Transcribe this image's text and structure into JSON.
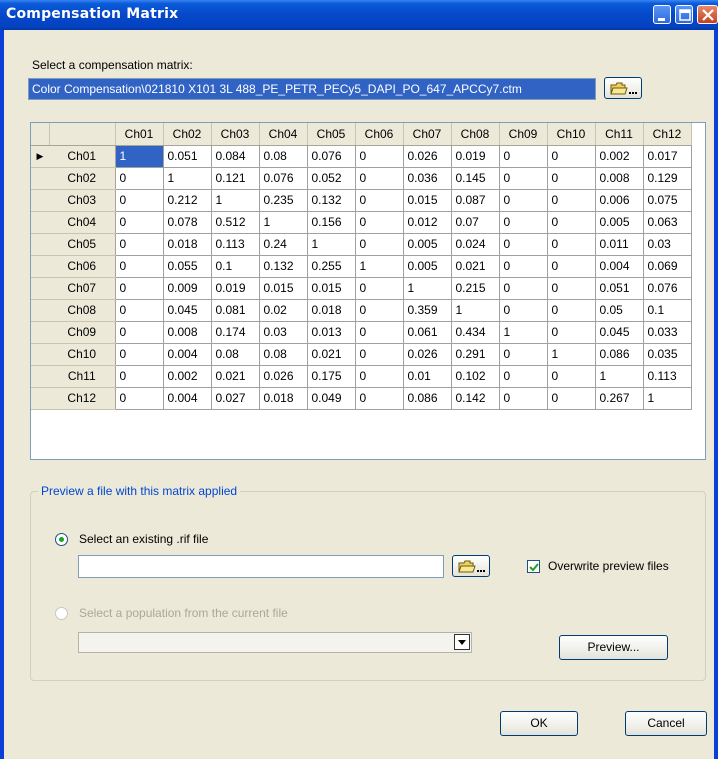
{
  "window": {
    "title": "Compensation Matrix"
  },
  "selector": {
    "label": "Select a compensation matrix:",
    "path": "Color Compensation\\021810 X101 3L 488_PE_PETR_PECy5_DAPI_PO_647_APCCy7.ctm",
    "browse_icon": "folder-open-icon"
  },
  "matrix": {
    "columns": [
      "Ch01",
      "Ch02",
      "Ch03",
      "Ch04",
      "Ch05",
      "Ch06",
      "Ch07",
      "Ch08",
      "Ch09",
      "Ch10",
      "Ch11",
      "Ch12"
    ],
    "rows": [
      {
        "label": "Ch01",
        "values": [
          "1",
          "0.051",
          "0.084",
          "0.08",
          "0.076",
          "0",
          "0.026",
          "0.019",
          "0",
          "0",
          "0.002",
          "0.017"
        ]
      },
      {
        "label": "Ch02",
        "values": [
          "0",
          "1",
          "0.121",
          "0.076",
          "0.052",
          "0",
          "0.036",
          "0.145",
          "0",
          "0",
          "0.008",
          "0.129"
        ]
      },
      {
        "label": "Ch03",
        "values": [
          "0",
          "0.212",
          "1",
          "0.235",
          "0.132",
          "0",
          "0.015",
          "0.087",
          "0",
          "0",
          "0.006",
          "0.075"
        ]
      },
      {
        "label": "Ch04",
        "values": [
          "0",
          "0.078",
          "0.512",
          "1",
          "0.156",
          "0",
          "0.012",
          "0.07",
          "0",
          "0",
          "0.005",
          "0.063"
        ]
      },
      {
        "label": "Ch05",
        "values": [
          "0",
          "0.018",
          "0.113",
          "0.24",
          "1",
          "0",
          "0.005",
          "0.024",
          "0",
          "0",
          "0.011",
          "0.03"
        ]
      },
      {
        "label": "Ch06",
        "values": [
          "0",
          "0.055",
          "0.1",
          "0.132",
          "0.255",
          "1",
          "0.005",
          "0.021",
          "0",
          "0",
          "0.004",
          "0.069"
        ]
      },
      {
        "label": "Ch07",
        "values": [
          "0",
          "0.009",
          "0.019",
          "0.015",
          "0.015",
          "0",
          "1",
          "0.215",
          "0",
          "0",
          "0.051",
          "0.076"
        ]
      },
      {
        "label": "Ch08",
        "values": [
          "0",
          "0.045",
          "0.081",
          "0.02",
          "0.018",
          "0",
          "0.359",
          "1",
          "0",
          "0",
          "0.05",
          "0.1"
        ]
      },
      {
        "label": "Ch09",
        "values": [
          "0",
          "0.008",
          "0.174",
          "0.03",
          "0.013",
          "0",
          "0.061",
          "0.434",
          "1",
          "0",
          "0.045",
          "0.033"
        ]
      },
      {
        "label": "Ch10",
        "values": [
          "0",
          "0.004",
          "0.08",
          "0.08",
          "0.021",
          "0",
          "0.026",
          "0.291",
          "0",
          "1",
          "0.086",
          "0.035"
        ]
      },
      {
        "label": "Ch11",
        "values": [
          "0",
          "0.002",
          "0.021",
          "0.026",
          "0.175",
          "0",
          "0.01",
          "0.102",
          "0",
          "0",
          "1",
          "0.113"
        ]
      },
      {
        "label": "Ch12",
        "values": [
          "0",
          "0.004",
          "0.027",
          "0.018",
          "0.049",
          "0",
          "0.086",
          "0.142",
          "0",
          "0",
          "0.267",
          "1"
        ]
      }
    ],
    "current_row_marker": "▶"
  },
  "preview": {
    "group_title": "Preview a file with this matrix applied",
    "option_existing": "Select an existing .rif file",
    "existing_path": "",
    "overwrite_label": "Overwrite preview files",
    "overwrite_checked": true,
    "option_population": "Select a population from the current file",
    "population_value": "",
    "preview_button": "Preview..."
  },
  "footer": {
    "ok": "OK",
    "cancel": "Cancel"
  },
  "colors": {
    "title_bar": "#0548c9",
    "selection": "#3163c5",
    "group_title": "#0046d5"
  }
}
